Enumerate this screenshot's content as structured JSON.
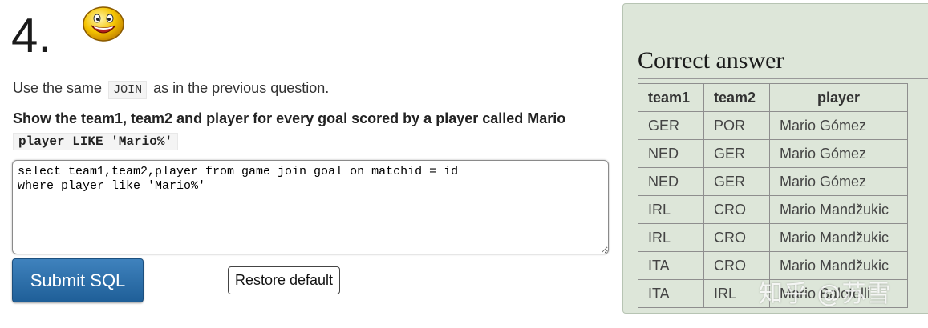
{
  "question": {
    "number": "4.",
    "intro_before": "Use the same",
    "intro_code": "JOIN",
    "intro_after": "as in the previous question.",
    "prompt": "Show the team1, team2 and player for every goal scored by a player called Mario",
    "prompt_code": "player LIKE 'Mario%'"
  },
  "editor": {
    "sql": "select team1,team2,player from game join goal on matchid = id\nwhere player like 'Mario%'"
  },
  "buttons": {
    "submit": "Submit SQL",
    "restore": "Restore default"
  },
  "answer": {
    "title": "Correct answer",
    "columns": [
      "team1",
      "team2",
      "player"
    ],
    "rows": [
      [
        "GER",
        "POR",
        "Mario Gómez"
      ],
      [
        "NED",
        "GER",
        "Mario Gómez"
      ],
      [
        "NED",
        "GER",
        "Mario Gómez"
      ],
      [
        "IRL",
        "CRO",
        "Mario Mandžukic"
      ],
      [
        "IRL",
        "CRO",
        "Mario Mandžukic"
      ],
      [
        "ITA",
        "CRO",
        "Mario Mandžukic"
      ],
      [
        "ITA",
        "IRL",
        "Mario Balotelli"
      ]
    ]
  },
  "watermark": "知乎 @苏雪",
  "colors": {
    "submit_bg": "#2a6aa6",
    "answer_panel_bg": "#dde6d9"
  },
  "icons": {
    "smiley": "smiley-face-icon"
  }
}
